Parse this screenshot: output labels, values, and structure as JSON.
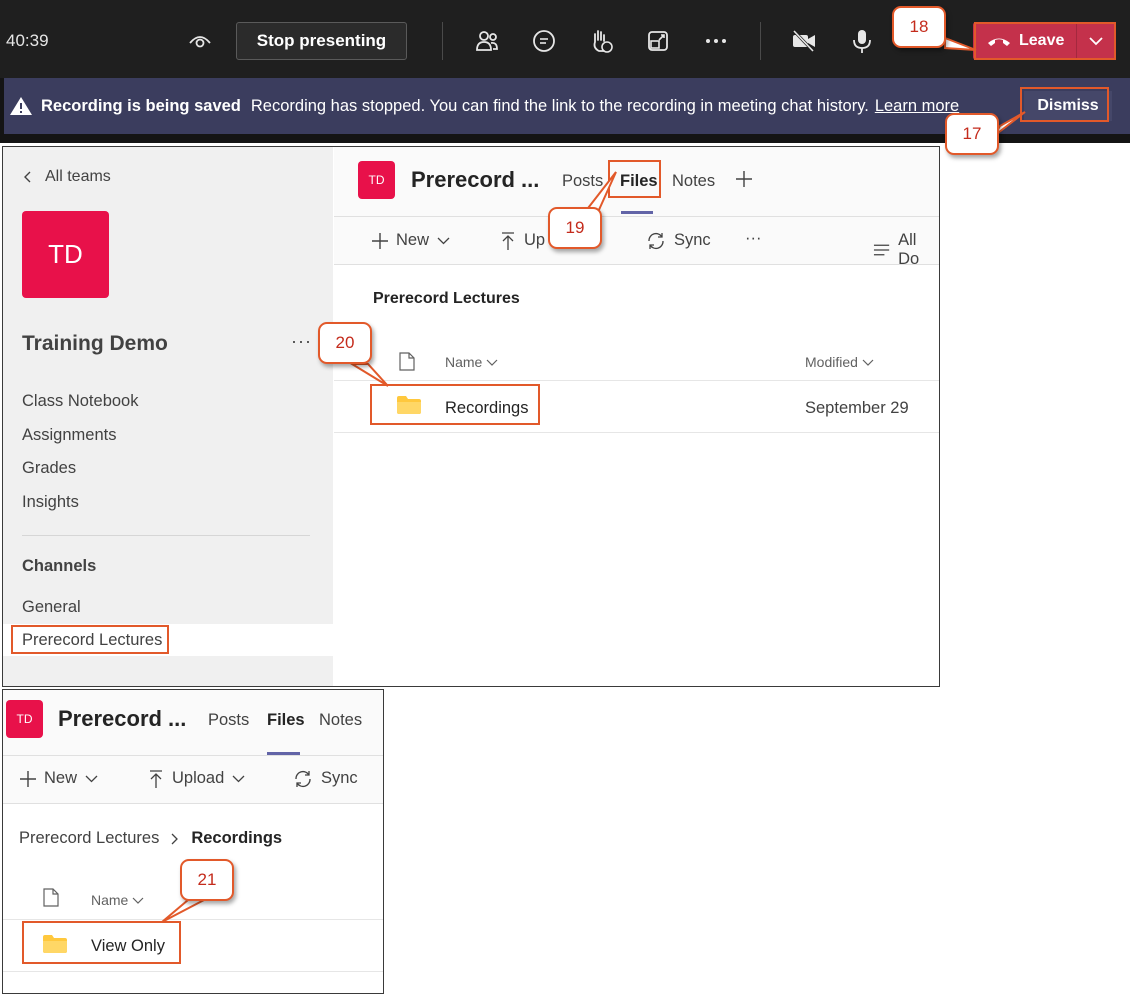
{
  "meeting": {
    "timer": "40:39",
    "stop_presenting": "Stop presenting",
    "leave": "Leave",
    "icons": [
      "eye-icon",
      "people-icon",
      "chat-icon",
      "raise-hand-icon",
      "share-tray-icon",
      "more-icon",
      "camera-off-icon",
      "microphone-icon",
      "phone-hangup-icon"
    ]
  },
  "banner": {
    "title": "Recording is being saved",
    "message": "Recording has stopped. You can find the link to the recording in meeting chat history.",
    "link": "Learn more",
    "dismiss": "Dismiss"
  },
  "sidebar": {
    "back": "All teams",
    "avatar": "TD",
    "team_name": "Training Demo",
    "more": "···",
    "items": [
      "Class Notebook",
      "Assignments",
      "Grades",
      "Insights"
    ],
    "channels_heading": "Channels",
    "channels": [
      "General",
      "Prerecord Lectures"
    ]
  },
  "channel": {
    "avatar": "TD",
    "title": "Prerecord ...",
    "tabs": [
      "Posts",
      "Files",
      "Notes"
    ],
    "commands": {
      "new": "New",
      "upload_a": "Up",
      "upload": "Upload",
      "sync": "Sync",
      "more": "···",
      "all_docs": "All Do"
    }
  },
  "files_a": {
    "breadcrumb": "Prerecord Lectures",
    "col_name": "Name",
    "col_modified": "Modified",
    "row_name": "Recordings",
    "row_modified": "September 29"
  },
  "files_b": {
    "breadcrumb_parent": "Prerecord Lectures",
    "breadcrumb_current": "Recordings",
    "col_name": "Name",
    "row_name": "View Only"
  },
  "callouts": {
    "c17": "17",
    "c18": "18",
    "c19": "19",
    "c20": "20",
    "c21": "21"
  },
  "colors": {
    "accent": "#6264a7",
    "leave": "#c4314b",
    "avatar": "#e8114a",
    "callout": "#e2592a",
    "folder": "#ffc83d"
  }
}
